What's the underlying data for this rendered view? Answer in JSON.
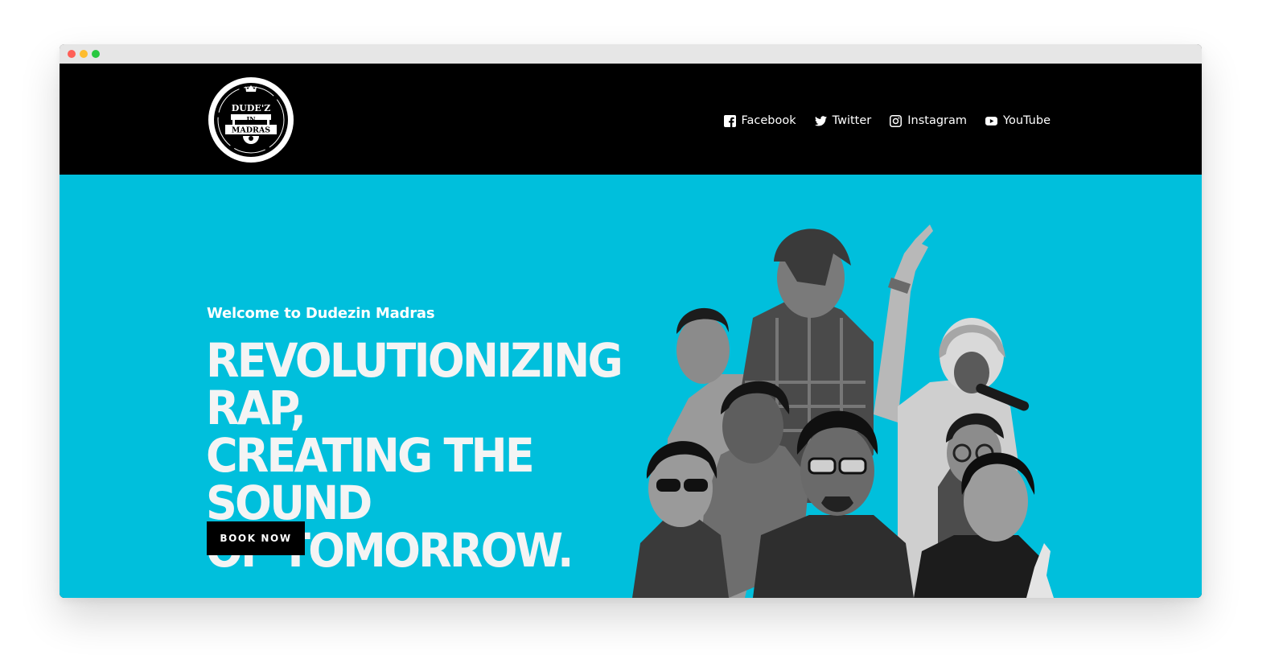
{
  "brand": {
    "logo_text_top": "DUDE'Z",
    "logo_text_mid": "IN",
    "logo_text_bottom": "MADRAS"
  },
  "nav": {
    "items": [
      {
        "label": "Facebook",
        "icon": "facebook-icon"
      },
      {
        "label": "Twitter",
        "icon": "twitter-icon"
      },
      {
        "label": "Instagram",
        "icon": "instagram-icon"
      },
      {
        "label": "YouTube",
        "icon": "youtube-icon"
      }
    ]
  },
  "hero": {
    "welcome": "Welcome to Dudezin Madras",
    "headline_lines": [
      "REVOLUTIONIZING RAP,",
      "CREATING THE SOUND",
      "OF TOMORROW."
    ],
    "cta_label": "BOOK NOW",
    "image_alt": "Black and white group photo of rap artists"
  },
  "colors": {
    "header_bg": "#000000",
    "hero_bg": "#00bfdc",
    "button_bg": "#000000",
    "text": "#ffffff"
  }
}
